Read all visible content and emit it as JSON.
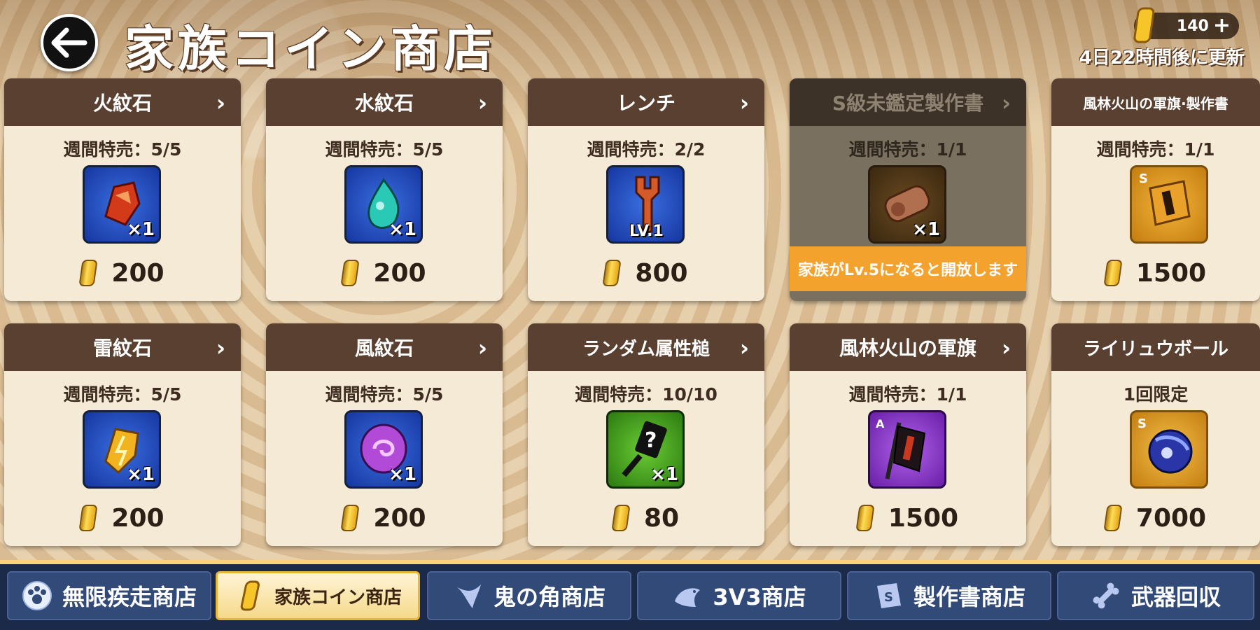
{
  "header": {
    "title": "家族コイン商店",
    "currency_amount": "140",
    "plus_symbol": "+",
    "refresh_text": "4日22時間後に更新"
  },
  "items": [
    {
      "name": "火紋石",
      "limit": "週間特売：5/5",
      "qty": "×1",
      "price": "200",
      "icon": "fire-gem-icon",
      "color": "#d8401e"
    },
    {
      "name": "水紋石",
      "limit": "週間特売：5/5",
      "qty": "×1",
      "price": "200",
      "icon": "water-gem-icon",
      "color": "#29c6b4"
    },
    {
      "name": "レンチ",
      "limit": "週間特売：2/2",
      "qty": "LV.1",
      "price": "800",
      "icon": "wrench-icon",
      "color": "#d25a2a"
    },
    {
      "name": "S級未鑑定製作書",
      "limit": "週間特売：1/1",
      "qty": "×1",
      "price": "",
      "icon": "scroll-icon",
      "color": "#c47d4a",
      "locked_text": "家族がLv.5になると開放します"
    },
    {
      "name": "風林火山の軍旗·製作書",
      "limit": "週間特売：1/1",
      "qty": "",
      "price": "1500",
      "icon": "banner-scroll-icon",
      "color": "#e9a12a"
    },
    {
      "name": "雷紋石",
      "limit": "週間特売：5/5",
      "qty": "×1",
      "price": "200",
      "icon": "thunder-gem-icon",
      "color": "#f1b31f"
    },
    {
      "name": "風紋石",
      "limit": "週間特売：5/5",
      "qty": "×1",
      "price": "200",
      "icon": "wind-gem-icon",
      "color": "#b14ad6"
    },
    {
      "name": "ランダム属性槌",
      "limit": "週間特売：10/10",
      "qty": "×1",
      "price": "80",
      "icon": "random-hammer-icon",
      "color": "#5fbb2b"
    },
    {
      "name": "風林火山の軍旗",
      "limit": "週間特売：1/1",
      "qty": "",
      "price": "1500",
      "icon": "war-banner-icon",
      "color": "#9a47d8"
    },
    {
      "name": "ライリュウボール",
      "limit": "1回限定",
      "qty": "",
      "price": "7000",
      "icon": "dragon-ball-icon",
      "color": "#3443b8"
    }
  ],
  "tabs": [
    {
      "label": "無限疾走商店",
      "icon": "paw-icon"
    },
    {
      "label": "家族コイン商店",
      "icon": "coin-icon"
    },
    {
      "label": "鬼の角商店",
      "icon": "horn-icon"
    },
    {
      "label": "3V3商店",
      "icon": "fish-icon"
    },
    {
      "label": "製作書商店",
      "icon": "scroll-tab-icon"
    },
    {
      "label": "武器回収",
      "icon": "bone-icon"
    }
  ],
  "active_tab_index": 1
}
